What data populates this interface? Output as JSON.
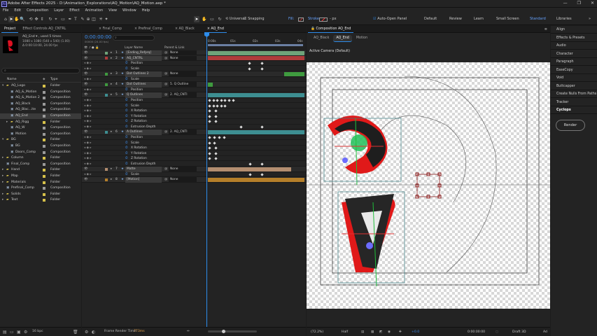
{
  "app": {
    "title": "Adobe After Effects 2025 - D:\\Animation_Explorations\\AQ_Motion\\AQ_Motion.aep *",
    "logo": "Ae",
    "window_controls": [
      "—",
      "❐",
      "✕"
    ]
  },
  "menu": [
    "File",
    "Edit",
    "Composition",
    "Layer",
    "Effect",
    "Animation",
    "View",
    "Window",
    "Help"
  ],
  "toolbar": {
    "tools": [
      {
        "name": "home-icon",
        "glyph": "⌂"
      },
      {
        "name": "selection-tool-icon",
        "glyph": "➤"
      },
      {
        "name": "hand-tool-icon",
        "glyph": "✋"
      },
      {
        "name": "zoom-tool-icon",
        "glyph": "🔍"
      },
      {
        "name": "orbit-camera-icon",
        "glyph": "⟲"
      },
      {
        "name": "track-camera-icon",
        "glyph": "✥"
      },
      {
        "name": "dolly-camera-icon",
        "glyph": "⇕"
      },
      {
        "name": "rotate-tool-icon",
        "glyph": "↻"
      },
      {
        "name": "pan-behind-icon",
        "glyph": "⌖"
      },
      {
        "name": "rectangle-tool-icon",
        "glyph": "▭"
      },
      {
        "name": "pen-tool-icon",
        "glyph": "✒"
      },
      {
        "name": "type-tool-icon",
        "glyph": "T"
      },
      {
        "name": "brush-tool-icon",
        "glyph": "✎"
      },
      {
        "name": "clone-stamp-icon",
        "glyph": "⊕"
      },
      {
        "name": "eraser-icon",
        "glyph": "◫"
      },
      {
        "name": "roto-brush-icon",
        "glyph": "✳"
      },
      {
        "name": "puppet-pin-icon",
        "glyph": "✦"
      }
    ],
    "tools2": [
      {
        "name": "selection-icon",
        "glyph": "➤"
      },
      {
        "name": "hand-icon",
        "glyph": "✋"
      },
      {
        "name": "rect-icon",
        "glyph": "▭"
      },
      {
        "name": "rotate-icon",
        "glyph": "↻"
      }
    ],
    "universal_label": "Universal",
    "snapping_label": "Snapping",
    "fill_label": "Fill:",
    "stroke_label": "Stroke:",
    "stroke_value": "- px",
    "auto_open_label": "Auto-Open Panel",
    "workspaces": [
      "Default",
      "Review",
      "Learn",
      "Small Screen",
      "Standard",
      "Libraries"
    ],
    "active_workspace": "Standard"
  },
  "project": {
    "tabs": [
      "Project",
      "Effect Controls AQ_CNTRL"
    ],
    "selected_name": "AQ_End ▾ , used 5 times",
    "selected_info1": "1080 x 1080 (540 x 540) (1.00)",
    "selected_info2": "Δ 0:00:10:00, 24.00 fps",
    "search_placeholder": "",
    "col_name": "Name",
    "col_type": "Type",
    "items": [
      {
        "indent": 0,
        "arrow": "▾",
        "name": "AQ_Logo",
        "color": "#d6c14a",
        "type": "Folder"
      },
      {
        "indent": 1,
        "arrow": "",
        "name": "AQ_&_Motion",
        "color": "#9a9a9a",
        "type": "Composition"
      },
      {
        "indent": 1,
        "arrow": "",
        "name": "AQ_&_Motion 2",
        "color": "#9a9a9a",
        "type": "Composition"
      },
      {
        "indent": 1,
        "arrow": "",
        "name": "AQ_Black",
        "color": "#9a9a9a",
        "type": "Composition"
      },
      {
        "indent": 1,
        "arrow": "",
        "name": "AQ_Blac...ite",
        "color": "#9a9a9a",
        "type": "Composition"
      },
      {
        "indent": 1,
        "arrow": "",
        "name": "AQ_End",
        "color": "#9a9a9a",
        "type": "Composition",
        "selected": true
      },
      {
        "indent": 1,
        "arrow": "▸",
        "name": "AQ_Rigg",
        "color": "#d6c14a",
        "type": "Folder"
      },
      {
        "indent": 1,
        "arrow": "",
        "name": "AQ_W",
        "color": "#9a9a9a",
        "type": "Composition"
      },
      {
        "indent": 1,
        "arrow": "",
        "name": "Motion",
        "color": "#9a9a9a",
        "type": "Composition"
      },
      {
        "indent": 0,
        "arrow": "▾",
        "name": "BG",
        "color": "#d6c14a",
        "type": "Folder"
      },
      {
        "indent": 1,
        "arrow": "",
        "name": "BG",
        "color": "#9a9a9a",
        "type": "Composition"
      },
      {
        "indent": 1,
        "arrow": "",
        "name": "Doors_Comp",
        "color": "#9a9a9a",
        "type": "Composition"
      },
      {
        "indent": 0,
        "arrow": "▸",
        "name": "Column",
        "color": "#d6c14a",
        "type": "Folder"
      },
      {
        "indent": 0,
        "arrow": "",
        "name": "Final_Comp",
        "color": "#9a9a9a",
        "type": "Composition"
      },
      {
        "indent": 0,
        "arrow": "▸",
        "name": "Hand",
        "color": "#d6c14a",
        "type": "Folder"
      },
      {
        "indent": 0,
        "arrow": "▸",
        "name": "Map",
        "color": "#d6c14a",
        "type": "Folder"
      },
      {
        "indent": 0,
        "arrow": "▸",
        "name": "Materials",
        "color": "#d6c14a",
        "type": "Folder"
      },
      {
        "indent": 0,
        "arrow": "",
        "name": "Prefinal_Comp",
        "color": "#9a9a9a",
        "type": "Composition"
      },
      {
        "indent": 0,
        "arrow": "▸",
        "name": "Solids",
        "color": "#d6c14a",
        "type": "Folder"
      },
      {
        "indent": 0,
        "arrow": "▸",
        "name": "Text",
        "color": "#d6c14a",
        "type": "Folder"
      }
    ],
    "bpc": "16 bpc"
  },
  "timeline": {
    "tabs": [
      "Final_Comp",
      "Prefinal_Comp",
      "AQ_Black",
      "AQ_End"
    ],
    "active_tab": "AQ_End",
    "timecode": "0:00:00:00",
    "timecode_sub": "00000 (24.00 fps)",
    "col_layer": "Layer Name",
    "col_parent": "Parent & Link",
    "ruler": [
      "0:00s",
      "01s",
      "02s",
      "03s",
      "04s"
    ],
    "rows": [
      {
        "num": "1",
        "name": "[Ending_Refprq]",
        "parent": "None",
        "kind": "layer",
        "bar": "#6fa37a",
        "bar_from": 0,
        "bar_to": 1
      },
      {
        "num": "2",
        "name": "AQ_CNTRL",
        "parent": "None",
        "kind": "layer",
        "bar": "#b03b3b",
        "bar_from": 0,
        "bar_to": 1
      },
      {
        "num": "",
        "name": "Position",
        "parent": "",
        "kind": "prop",
        "kfs": [
          0.42,
          0.55
        ]
      },
      {
        "num": "",
        "name": "Scale",
        "parent": "",
        "kind": "prop",
        "kfs": [
          0.42,
          0.55
        ]
      },
      {
        "num": "3",
        "name": "Dot Outlines 2",
        "parent": "None",
        "kind": "layer",
        "bar": "#3f9b3f",
        "bar_from": 0.79,
        "bar_to": 1
      },
      {
        "num": "",
        "name": "Scale",
        "parent": "",
        "kind": "prop",
        "kfs": []
      },
      {
        "num": "4",
        "name": "Dot Outlines",
        "parent": "5. Q Outline",
        "kind": "layer",
        "bar": "#3f9b3f",
        "bar_from": 0,
        "bar_to": 0.05
      },
      {
        "num": "",
        "name": "Position",
        "parent": "",
        "kind": "prop",
        "kfs": []
      },
      {
        "num": "5",
        "name": "Q Outlines",
        "parent": "2. AQ_CNTI",
        "kind": "layer",
        "bar": "#3d8e91",
        "bar_from": 0,
        "bar_to": 1
      },
      {
        "num": "",
        "name": "Position",
        "parent": "",
        "kind": "prop",
        "kfs": [
          0.01,
          0.05,
          0.09,
          0.13,
          0.17,
          0.21,
          0.25
        ]
      },
      {
        "num": "",
        "name": "Scale",
        "parent": "",
        "kind": "prop",
        "kfs": [
          0.01,
          0.05,
          0.09,
          0.13,
          0.17
        ]
      },
      {
        "num": "",
        "name": "X Rotation",
        "parent": "",
        "kind": "prop",
        "kfs": [
          0.01,
          0.07
        ]
      },
      {
        "num": "",
        "name": "Y Rotation",
        "parent": "",
        "kind": "prop",
        "kfs": [
          0.01,
          0.07
        ]
      },
      {
        "num": "",
        "name": "Z Rotation",
        "parent": "",
        "kind": "prop",
        "kfs": [
          0.01,
          0.07
        ]
      },
      {
        "num": "",
        "name": "Extrusion Depth",
        "parent": "",
        "kind": "prop",
        "kfs": [
          0.33,
          0.55
        ]
      },
      {
        "num": "6",
        "name": "A Outlines",
        "parent": "2. AQ_CNTI",
        "kind": "layer",
        "bar": "#3d8e91",
        "bar_from": 0,
        "bar_to": 1
      },
      {
        "num": "",
        "name": "Position",
        "parent": "",
        "kind": "prop",
        "kfs": [
          0.01,
          0.06,
          0.11,
          0.16
        ]
      },
      {
        "num": "",
        "name": "Scale",
        "parent": "",
        "kind": "prop",
        "kfs": [
          0.01,
          0.06
        ]
      },
      {
        "num": "",
        "name": "X Rotation",
        "parent": "",
        "kind": "prop",
        "kfs": [
          0.01,
          0.07
        ]
      },
      {
        "num": "",
        "name": "Y Rotation",
        "parent": "",
        "kind": "prop",
        "kfs": [
          0.01,
          0.07
        ]
      },
      {
        "num": "",
        "name": "Z Rotation",
        "parent": "",
        "kind": "prop",
        "kfs": [
          0.01,
          0.07
        ]
      },
      {
        "num": "",
        "name": "Extrusion Depth",
        "parent": "",
        "kind": "prop",
        "kfs": [
          0.43,
          0.55
        ]
      },
      {
        "num": "7",
        "name": "Matte",
        "parent": "None",
        "kind": "layer",
        "bar": "#b38d6f",
        "bar_from": 0,
        "bar_to": 0.86
      },
      {
        "num": "",
        "name": "Scale",
        "parent": "",
        "kind": "prop",
        "kfs": [
          0.43,
          0.55
        ]
      },
      {
        "num": "8",
        "name": "[Motion]",
        "parent": "None",
        "kind": "layer",
        "bar": "#b57f2a",
        "bar_from": 0,
        "bar_to": 1
      }
    ],
    "render_label": "Frame Render Time:",
    "render_time": "773ms"
  },
  "composition": {
    "tab_label": "Composition AQ_End",
    "subtabs": [
      "AQ_Black",
      "AQ_End",
      "Motion"
    ],
    "active_subtab": "AQ_End",
    "camera_label": "Active Camera (Default)",
    "footer": {
      "zoom": "(72.2%)",
      "resolution": "Half",
      "exposure": "+0.0",
      "timecode": "0:00:00:00",
      "renderer": "Draft 3D",
      "extra": "Ad"
    }
  },
  "right_panels": [
    "Align",
    "Effects & Presets",
    "Audio",
    "Character",
    "Paragraph",
    "EaseCopy",
    "Void",
    "Buttcapper",
    "Create Nulls From Paths",
    "Tracker",
    "Cyclops"
  ],
  "render_button": "Render"
}
